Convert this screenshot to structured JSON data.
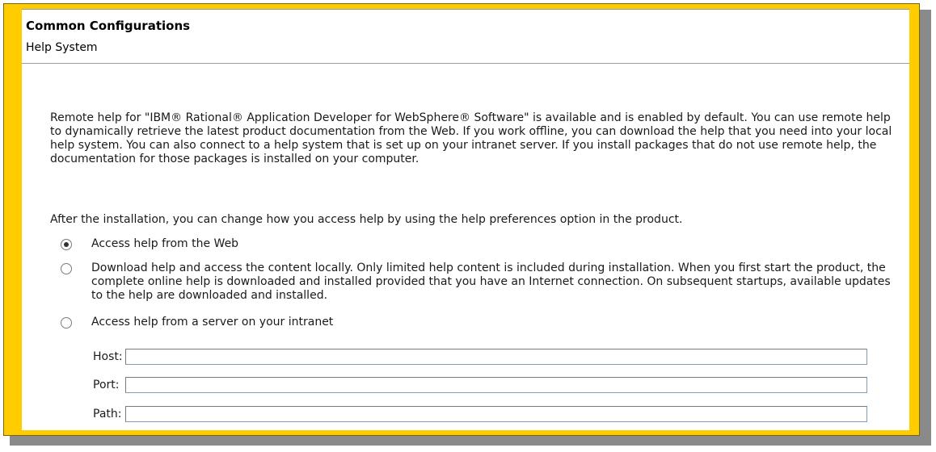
{
  "header": {
    "title": "Common Configurations",
    "subtitle": "Help System"
  },
  "intro_text": "Remote help for \"IBM® Rational® Application Developer for WebSphere® Software\" is available and is enabled by default. You can use remote help to dynamically retrieve the latest product documentation from the Web. If you work offline, you can download the help that you need into your local help system. You can also connect to a help system that is set up on your intranet server. If you install packages that do not use remote help, the documentation for those packages is installed on your computer.",
  "after_text": "After the installation, you can change how you  access help by using the help preferences option in the product.",
  "options": [
    {
      "label": "Access help from the Web",
      "selected": true
    },
    {
      "label": "Download help and access the content locally.  Only limited help content is included during installation.  When you first start the product, the complete online help is downloaded and installed provided that you have an Internet connection.  On subsequent startups, available updates to the help are downloaded and installed.",
      "selected": false
    },
    {
      "label": "Access help from a server on your intranet",
      "selected": false
    }
  ],
  "fields": {
    "host": {
      "label": "Host:",
      "value": ""
    },
    "port": {
      "label": "Port:",
      "value": ""
    },
    "path": {
      "label": "Path:",
      "value": ""
    }
  },
  "colors": {
    "frame": "#ffcc00",
    "shadow": "#8a8a8a"
  }
}
